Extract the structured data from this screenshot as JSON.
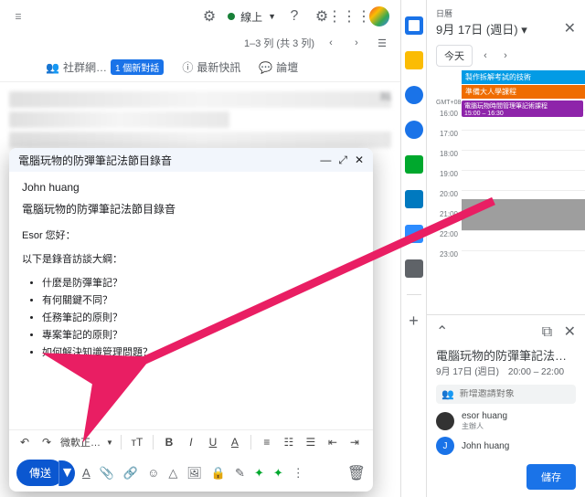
{
  "header": {
    "online_label": "線上",
    "pagination": "1–3 列 (共 3 列)"
  },
  "tabs": {
    "t1_label": "社群網…",
    "t1_badge": "1 個新對話",
    "t2_label": "最新快訊",
    "t3_label": "論壇"
  },
  "list": {
    "row1_count": "31"
  },
  "compose": {
    "title": "電腦玩物的防彈筆記法節目錄音",
    "to": "John huang",
    "subject": "電腦玩物的防彈筆記法節目錄音",
    "greeting": "Esor 您好：",
    "outline_intro": "以下是錄音訪談大綱：",
    "bullets": {
      "b1": "什麼是防彈筆記？",
      "b2": "有何關鍵不同？",
      "b3": "任務筆記的原則？",
      "b4": "專案筆記的原則？",
      "b5": "如何解決知識管理問題？"
    },
    "font_label": "微軟正…",
    "send_label": "傳送"
  },
  "calendar": {
    "date_label": "日曆",
    "date": "9月 17日 (週日)",
    "today": "今天",
    "gmt": "GMT+08",
    "allday": {
      "e1": "製作拆解考試的技術",
      "e2": "準備大人學課程"
    },
    "hours": {
      "h16": "16:00",
      "h17": "17:00",
      "h18": "18:00",
      "h19": "19:00",
      "h20": "20:00",
      "h21": "21:00",
      "h22": "22:00",
      "h23": "23:00"
    },
    "timed_event": {
      "title": "電腦玩物時間管理筆記術課程",
      "time": "15:00 – 16:30"
    },
    "event_detail": {
      "title": "電腦玩物的防彈筆記法節目…",
      "time": "9月 17日 (週日)　20:00 – 22:00",
      "guest_placeholder": "新增邀請對象",
      "organizer": "esor huang",
      "organizer_role": "主辦人",
      "guest": "John huang",
      "guest_initial": "J",
      "save": "儲存"
    }
  }
}
